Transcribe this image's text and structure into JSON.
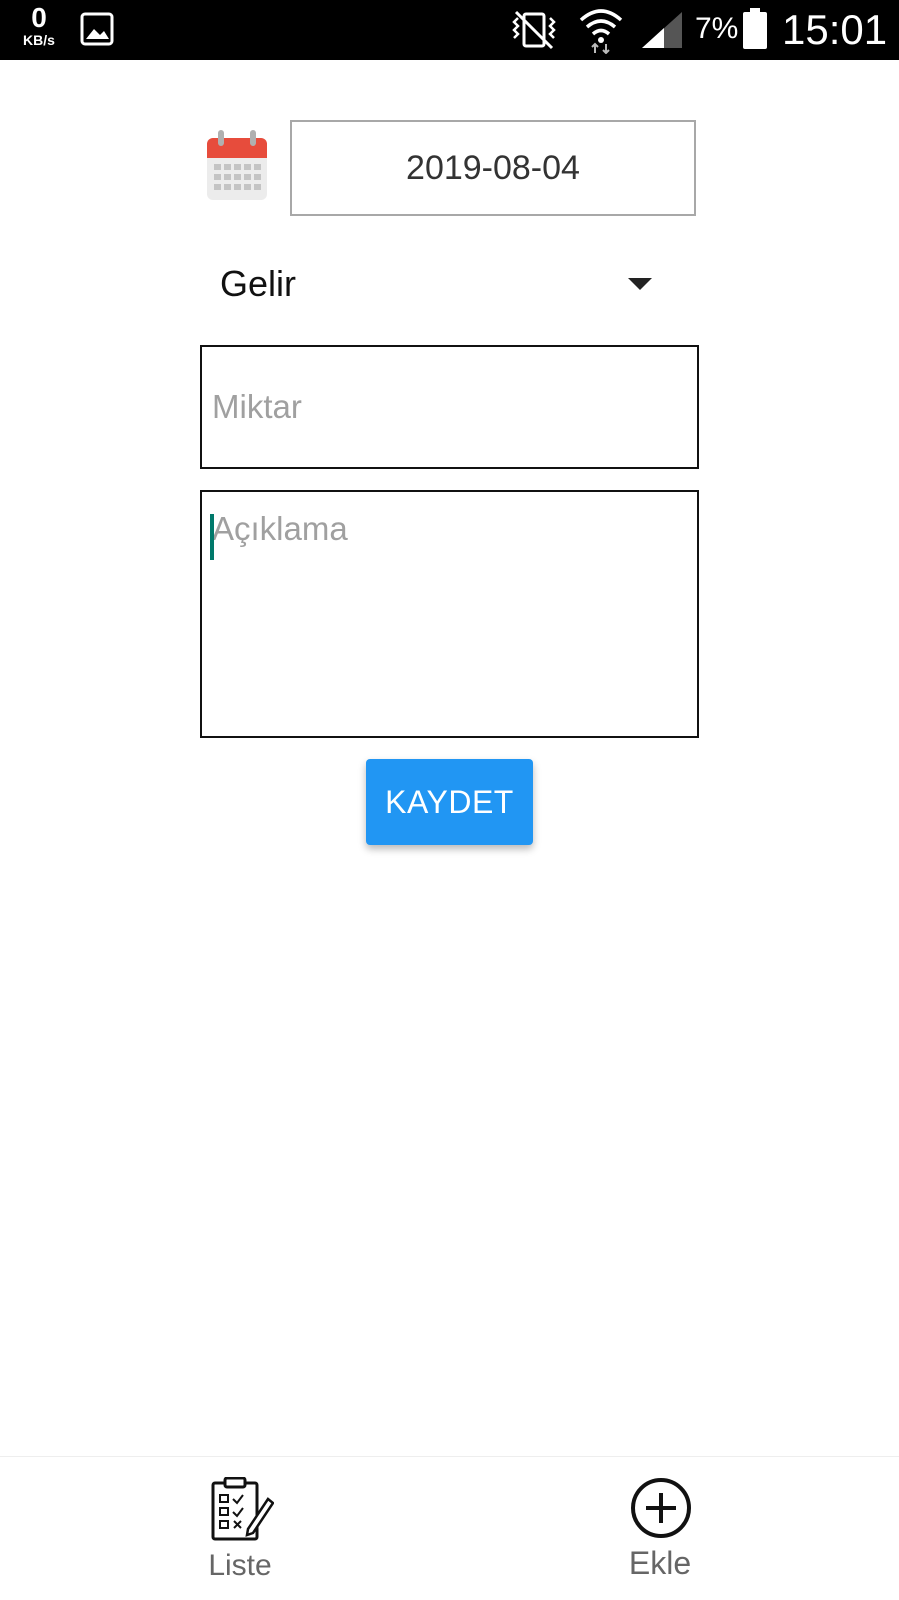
{
  "status_bar": {
    "speed_value": "0",
    "speed_unit": "KB/s",
    "battery_percent": "7%",
    "time": "15:01",
    "icons": [
      "gallery-icon",
      "vibrate-icon",
      "wifi-icon",
      "signal-icon",
      "battery-icon"
    ]
  },
  "form": {
    "date_value": "2019-08-04",
    "type_selected": "Gelir",
    "amount_placeholder": "Miktar",
    "description_placeholder": "Açıklama",
    "save_label": "KAYDET"
  },
  "bottom_nav": {
    "items": [
      {
        "label": "Liste",
        "icon": "checklist-icon"
      },
      {
        "label": "Ekle",
        "icon": "plus-circle-icon"
      }
    ]
  },
  "colors": {
    "primary_button": "#2196f3",
    "calendar_red": "#e74c3c",
    "cursor": "#00796b"
  }
}
